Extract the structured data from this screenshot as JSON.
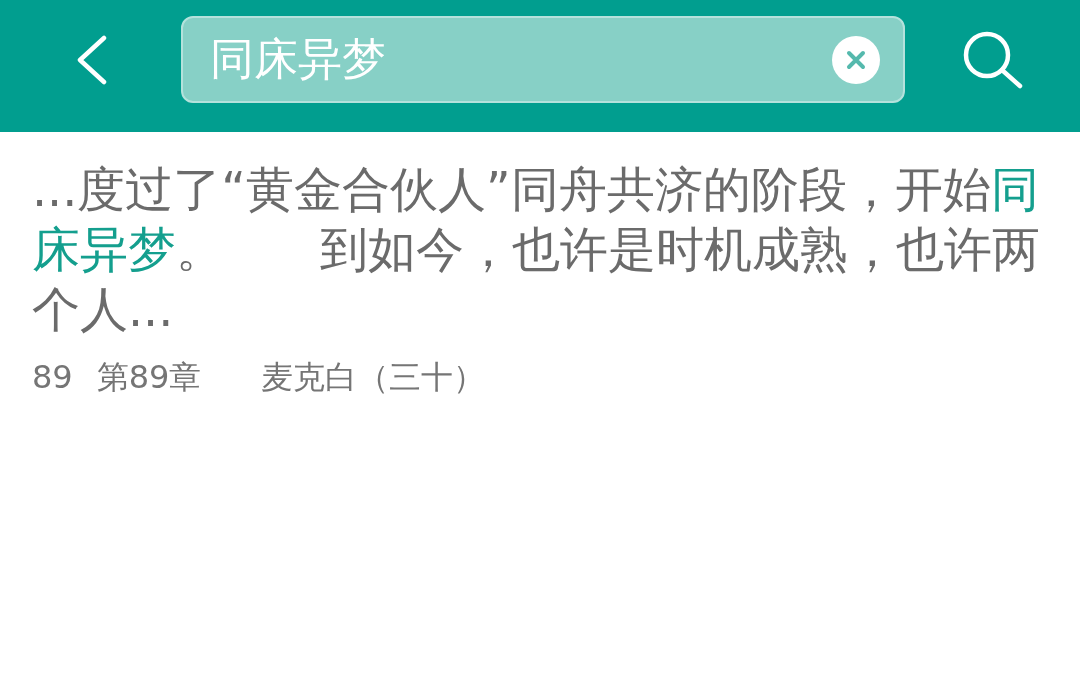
{
  "search_bar": {
    "value": "同床异梦"
  },
  "results": [
    {
      "snippet": [
        {
          "text": "...度过了“黄金合伙人”同舟共济的阶段，开始",
          "highlighted": false
        },
        {
          "text": "同床异梦",
          "highlighted": true
        },
        {
          "text": "。　　到如今，也许是时机成熟，也许两个人...",
          "highlighted": false
        }
      ],
      "number": "89",
      "chapter": "第89章",
      "title": "麦克白（三十）"
    }
  ]
}
